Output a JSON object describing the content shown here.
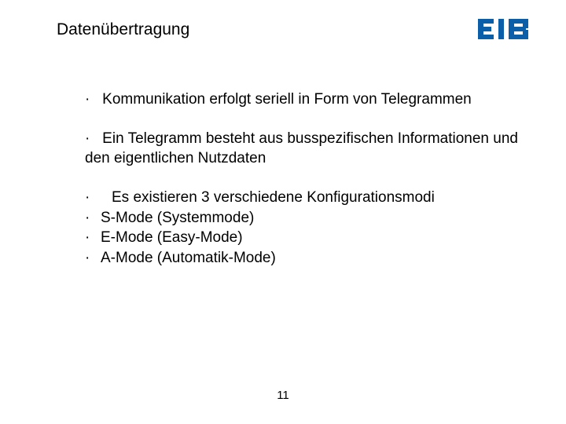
{
  "title": "Datenübertragung",
  "logo_text": "EIB",
  "bullets": {
    "b1": "Kommunikation erfolgt seriell in Form von Telegrammen",
    "b2": "Ein Telegramm besteht aus busspezifischen Informationen und den eigentlichen Nutzdaten",
    "b3": "Es existieren 3 verschiedene Konfigurationsmodi",
    "b3a": "S-Mode (Systemmode)",
    "b3b": "E-Mode (Easy-Mode)",
    "b3c": "A-Mode (Automatik-Mode)"
  },
  "page_number": "11"
}
